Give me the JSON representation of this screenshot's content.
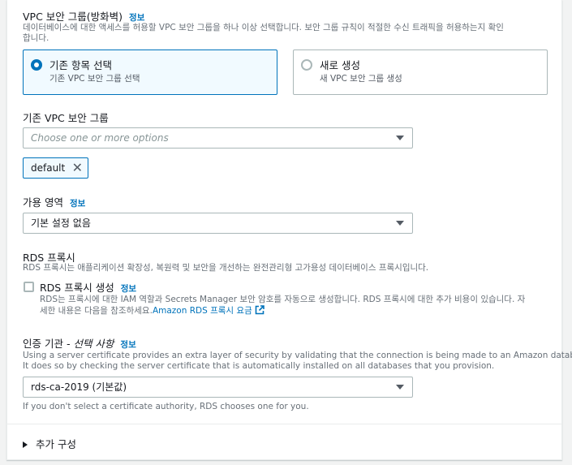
{
  "sg": {
    "title": "VPC 보안 그룹(방화벽)",
    "info": "정보",
    "desc_line1": "데이터베이스에 대한 액세스를 허용할 VPC 보안 그룹을 하나 이상 선택합니다. 보안 그룹 규칙이 적절한 수신 트래픽을 허용하는지 확인",
    "desc_line2": "합니다.",
    "options": [
      {
        "title": "기존 항목 선택",
        "sub": "기존 VPC 보안 그룹 선택",
        "selected": true
      },
      {
        "title": "새로 생성",
        "sub": "새 VPC 보안 그룹 생성",
        "selected": false
      }
    ]
  },
  "existing": {
    "label": "기존 VPC 보안 그룹",
    "placeholder": "Choose one or more options",
    "token": "default"
  },
  "az": {
    "label": "가용 영역",
    "info": "정보",
    "value": "기본 설정 없음"
  },
  "rds_proxy": {
    "title": "RDS 프록시",
    "desc": "RDS 프록시는 애플리케이션 확장성, 복원력 및 보안을 개선하는 완전관리형 고가용성 데이터베이스 프록시입니다.",
    "checkbox_label": "RDS 프록시 생성",
    "info": "정보",
    "checkbox_desc_line1": "RDS는 프록시에 대한 IAM 역할과 Secrets Manager 보안 암호를 자동으로 생성합니다. RDS 프록시에 대한 추가 비용이 있습니다. 자",
    "checkbox_desc_line2": "세한 내용은 다음을 참조하세요.",
    "link": "Amazon RDS 프록시 요금"
  },
  "ca": {
    "label": "인증 기관",
    "label_suffix": " - 선택 사항",
    "info": "정보",
    "desc_line1": "Using a server certificate provides an extra layer of security by validating that the connection is being made to an Amazon database.",
    "desc_line2": "It does so by checking the server certificate that is automatically installed on all databases that you provision.",
    "value": "rds-ca-2019 (기본값)",
    "hint": "If you don't select a certificate authority, RDS chooses one for you."
  },
  "additional": {
    "label": "추가 구성"
  },
  "colors": {
    "accent": "#0073bb",
    "border": "#aab7b8",
    "muted": "#687078"
  }
}
